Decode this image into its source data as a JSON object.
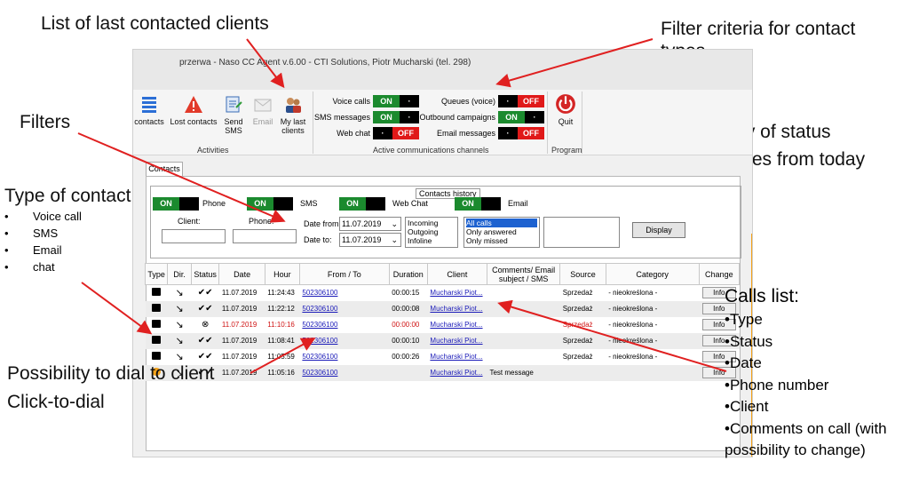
{
  "annotations": {
    "last_clients": "List of last contacted clients",
    "filter_criteria": "Filter criteria for contact types",
    "filters": "Filters",
    "history_status_1": "History of status",
    "history_status_2": "Changes from today",
    "type_of_contact": "Type of contact:",
    "contact_types": [
      "Voice call",
      "SMS",
      "Email",
      "chat"
    ],
    "dial_1": "Possibility to dial to client",
    "dial_2": "Click-to-dial",
    "calls_list_title": "Calls list:",
    "calls_list_items": [
      "•Type",
      "•Status",
      "•Date",
      "•Phone number",
      "•Client",
      "•Comments on call (with",
      "possibility to change)"
    ]
  },
  "window": {
    "title": "przerwa - Naso CC Agent v.6.00 - CTI Solutions, Piotr Mucharski (tel. 298)"
  },
  "ribbon": {
    "contacts": "contacts",
    "lost_contacts": "Lost contacts",
    "send_sms_1": "Send",
    "send_sms_2": "SMS",
    "email": "Email",
    "my_last_1": "My last",
    "my_last_2": "clients",
    "activities_label": "Activities",
    "channels_label": "Active communications channels",
    "quit": "Quit",
    "program_label": "Program",
    "channels": {
      "voice_calls": "Voice calls",
      "sms_messages": "SMS messages",
      "web_chat": "Web chat",
      "queues_voice": "Queues (voice)",
      "outbound_campaigns": "Outbound campaigns",
      "email_messages": "Email messages"
    },
    "on": "ON",
    "off": "OFF"
  },
  "tab": {
    "contacts": "Contacts"
  },
  "history": {
    "legend": "Contacts history",
    "phone": "Phone",
    "sms": "SMS",
    "web_chat": "Web Chat",
    "email": "Email",
    "client_label": "Client:",
    "phone_label": "Phone:",
    "date_from_label": "Date from:",
    "date_to_label": "Date to:",
    "date_from": "11.07.2019",
    "date_to": "11.07.2019",
    "direction_options": [
      "Incoming",
      "Outgoing",
      "Infoline"
    ],
    "answer_options": [
      "All calls",
      "Only answered",
      "Only missed"
    ],
    "display": "Display"
  },
  "table": {
    "headers": [
      "Type",
      "Dir.",
      "Status",
      "Date",
      "Hour",
      "From / To",
      "Duration",
      "Client",
      "Comments/ Email subject / SMS",
      "Source",
      "Category",
      "Change"
    ],
    "rows": [
      {
        "date": "11.07.2019",
        "hour": "11:24:43",
        "number": "502306100",
        "duration": "00:00:15",
        "client": "Mucharski Piot...",
        "comment": "",
        "source": "Sprzedaż",
        "category": "- nieokreślona -",
        "change": "Info",
        "status": "✔✔"
      },
      {
        "date": "11.07.2019",
        "hour": "11:22:12",
        "number": "502306100",
        "duration": "00:00:08",
        "client": "Mucharski Piot...",
        "comment": "",
        "source": "Sprzedaż",
        "category": "- nieokreślona -",
        "change": "Info",
        "status": "✔✔"
      },
      {
        "date": "11.07.2019",
        "hour": "11:10:16",
        "number": "502306100",
        "duration": "00:00:00",
        "client": "Mucharski Piot...",
        "comment": "",
        "source": "Sprzedaż",
        "category": "- nieokreślona -",
        "change": "Info",
        "status": "⊗"
      },
      {
        "date": "11.07.2019",
        "hour": "11:08:41",
        "number": "502306100",
        "duration": "00:00:10",
        "client": "Mucharski Piot...",
        "comment": "",
        "source": "Sprzedaż",
        "category": "- nieokreślona -",
        "change": "Info",
        "status": "✔✔"
      },
      {
        "date": "11.07.2019",
        "hour": "11:05:59",
        "number": "502306100",
        "duration": "00:00:26",
        "client": "Mucharski Piot...",
        "comment": "",
        "source": "Sprzedaż",
        "category": "- nieokreślona -",
        "change": "Info",
        "status": "✔✔"
      },
      {
        "date": "11.07.2019",
        "hour": "11:05:16",
        "number": "502306100",
        "duration": "",
        "client": "Mucharski Piot...",
        "comment": "Test message",
        "source": "",
        "category": "",
        "change": "Info",
        "status": "✔✔"
      }
    ]
  },
  "colors": {
    "on_green": "#1b8a2e",
    "off_red": "#e01919",
    "arrow_red": "#e02020",
    "link_blue": "#1a1ab8",
    "accent_orange": "#f3a21a"
  }
}
